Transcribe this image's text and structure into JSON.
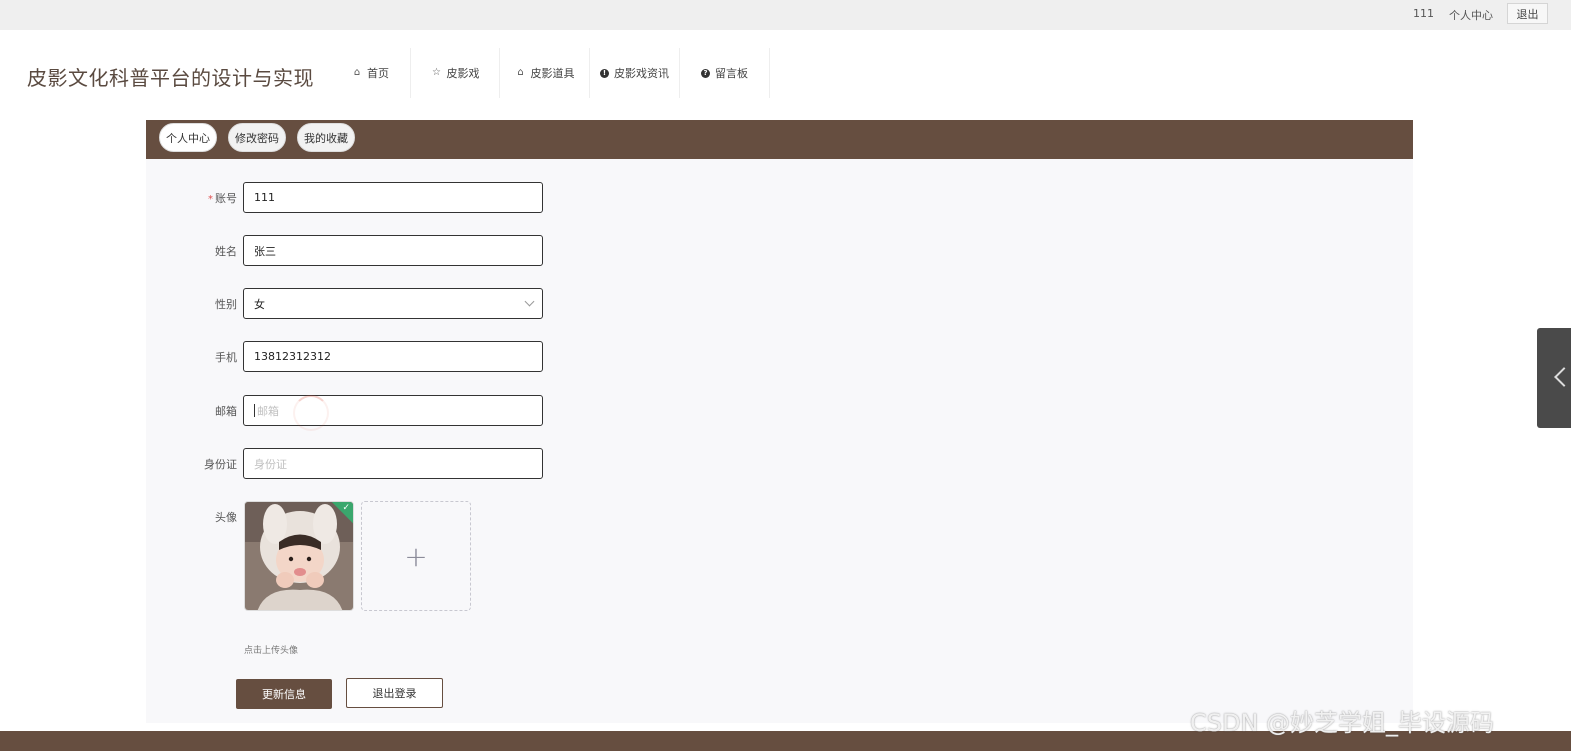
{
  "topbar": {
    "username": "111",
    "center_label": "个人中心",
    "logout_label": "退出"
  },
  "header": {
    "site_title": "皮影文化科普平台的设计与实现",
    "nav": [
      {
        "label": "首页",
        "icon": "home-icon"
      },
      {
        "label": "皮影戏",
        "icon": "star-icon"
      },
      {
        "label": "皮影道具",
        "icon": "bag-icon"
      },
      {
        "label": "皮影戏资讯",
        "icon": "info-icon"
      },
      {
        "label": "留言板",
        "icon": "question-icon"
      }
    ]
  },
  "tabs": [
    {
      "label": "个人中心",
      "active": true
    },
    {
      "label": "修改密码",
      "active": false
    },
    {
      "label": "我的收藏",
      "active": false
    }
  ],
  "form": {
    "account": {
      "label": "账号",
      "required_mark": "*",
      "value": "111"
    },
    "name": {
      "label": "姓名",
      "value": "张三"
    },
    "gender": {
      "label": "性别",
      "value": "女"
    },
    "phone": {
      "label": "手机",
      "value": "13812312312"
    },
    "email": {
      "label": "邮箱",
      "placeholder": "邮箱"
    },
    "idcard": {
      "label": "身份证",
      "placeholder": "身份证"
    },
    "avatar": {
      "label": "头像",
      "hint": "点击上传头像",
      "add_symbol": "+"
    }
  },
  "buttons": {
    "update": "更新信息",
    "logout": "退出登录"
  },
  "watermark": "CSDN @妙芝学姐_毕设源码",
  "colors": {
    "brand": "#664e40",
    "success": "#3aa76d"
  }
}
